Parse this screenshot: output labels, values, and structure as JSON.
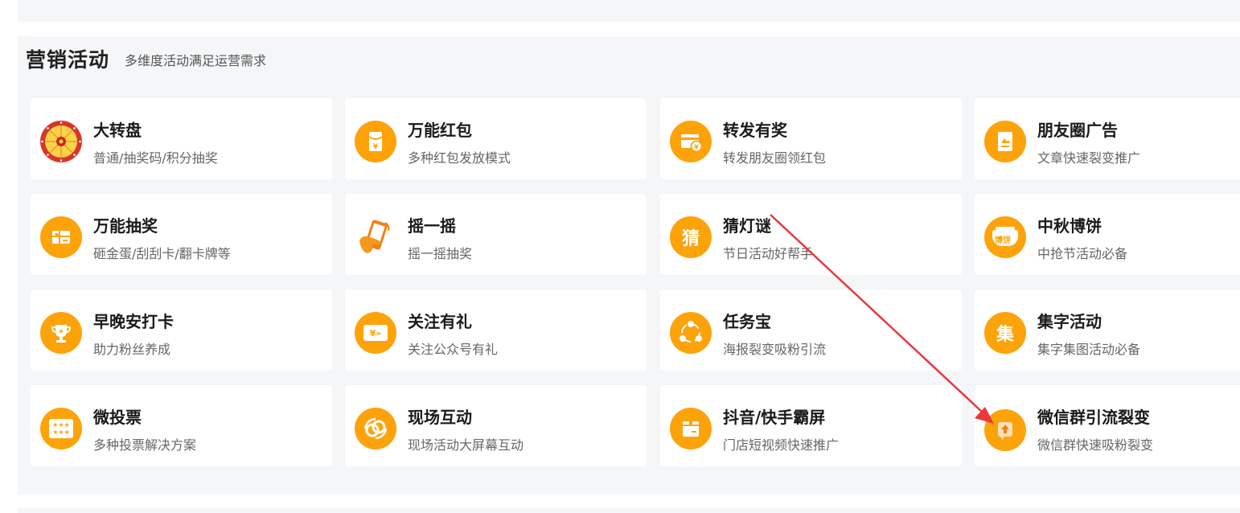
{
  "section": {
    "title": "营销活动",
    "subtitle": "多维度活动满足运营需求"
  },
  "cards": [
    {
      "title": "大转盘",
      "desc": "普通/抽奖码/积分抽奖",
      "icon": "prize-wheel-icon"
    },
    {
      "title": "万能红包",
      "desc": "多种红包发放模式",
      "icon": "red-packet-icon"
    },
    {
      "title": "转发有奖",
      "desc": "转发朋友圈领红包",
      "icon": "wallet-coin-icon"
    },
    {
      "title": "朋友圈广告",
      "desc": "文章快速裂变推广",
      "icon": "poster-icon"
    },
    {
      "title": "万能抽奖",
      "desc": "砸金蛋/刮刮卡/翻卡牌等",
      "icon": "gift-card-icon"
    },
    {
      "title": "摇一摇",
      "desc": "摇一摇抽奖",
      "icon": "hand-phone-icon"
    },
    {
      "title": "猜灯谜",
      "desc": "节日活动好帮手",
      "icon": "guess-char-icon",
      "icon_char": "猜"
    },
    {
      "title": "中秋博饼",
      "desc": "中抢节活动必备",
      "icon": "mooncake-bowl-icon",
      "icon_char": "博饼"
    },
    {
      "title": "早晚安打卡",
      "desc": "助力粉丝养成",
      "icon": "trophy-icon"
    },
    {
      "title": "关注有礼",
      "desc": "关注公众号有礼",
      "icon": "coupon-icon",
      "icon_char": "¥»"
    },
    {
      "title": "任务宝",
      "desc": "海报裂变吸粉引流",
      "icon": "share-nodes-icon"
    },
    {
      "title": "集字活动",
      "desc": "集字集图活动必备",
      "icon": "collect-char-icon",
      "icon_char": "集"
    },
    {
      "title": "微投票",
      "desc": "多种投票解决方案",
      "icon": "vote-stars-icon",
      "icon_char": "★★★"
    },
    {
      "title": "现场互动",
      "desc": "现场活动大屏幕互动",
      "icon": "link-rings-icon"
    },
    {
      "title": "抖音/快手霸屏",
      "desc": "门店短视频快速推广",
      "icon": "box-screen-icon"
    },
    {
      "title": "微信群引流裂变",
      "desc": "微信群快速吸粉裂变",
      "icon": "upload-arrow-icon"
    }
  ],
  "colors": {
    "accent": "#fda30a",
    "arrow": "#e8383d",
    "background": "#f5f6f8"
  }
}
